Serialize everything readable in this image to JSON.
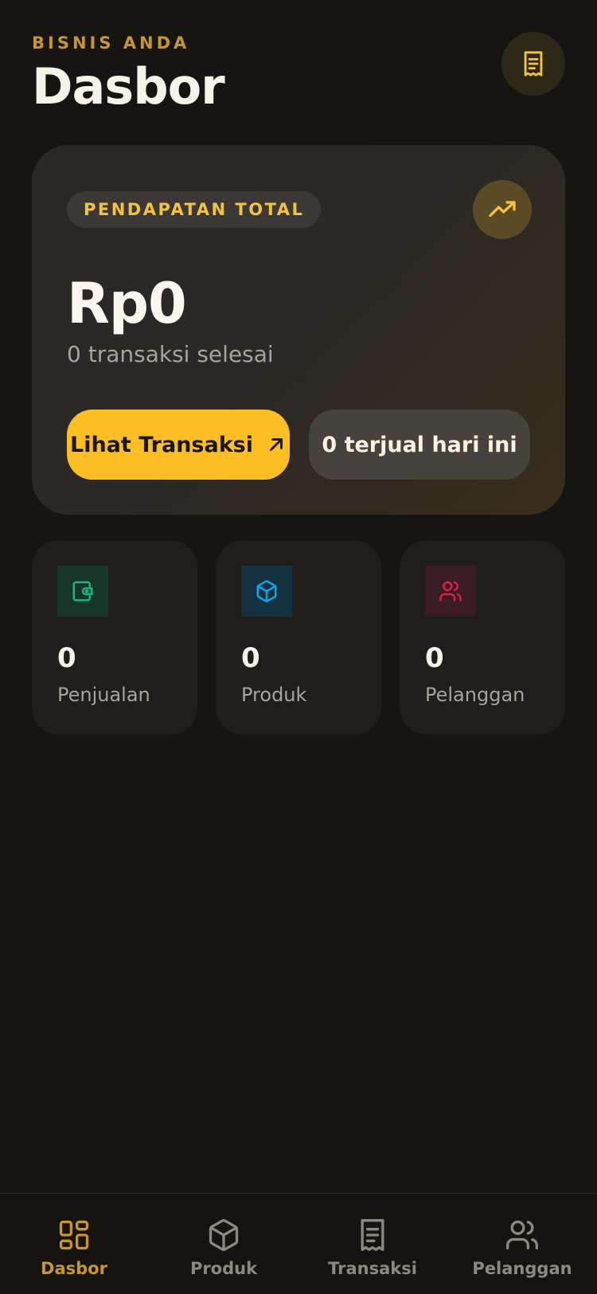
{
  "header": {
    "eyebrow": "BISNIS ANDA",
    "title": "Dasbor",
    "receipt_icon": "receipt-icon"
  },
  "hero": {
    "badge": "PENDAPATAN TOTAL",
    "trend_icon": "trending-up-icon",
    "amount": "Rp0",
    "subtitle": "0 transaksi selesai",
    "primary_button": "Lihat Transaksi",
    "primary_button_icon": "arrow-up-right-icon",
    "secondary_button": "0 terjual hari ini"
  },
  "stats": [
    {
      "value": "0",
      "label": "Penjualan",
      "icon": "wallet-icon",
      "color": "#10b981"
    },
    {
      "value": "0",
      "label": "Produk",
      "icon": "box-icon",
      "color": "#0ea5e9"
    },
    {
      "value": "0",
      "label": "Pelanggan",
      "icon": "users-icon",
      "color": "#e11d48"
    }
  ],
  "nav": {
    "items": [
      {
        "label": "Dasbor",
        "icon": "grid-icon",
        "active": true
      },
      {
        "label": "Produk",
        "icon": "box-icon",
        "active": false
      },
      {
        "label": "Transaksi",
        "icon": "receipt-icon",
        "active": false
      },
      {
        "label": "Pelanggan",
        "icon": "users-icon",
        "active": false
      }
    ]
  },
  "colors": {
    "background": "#161512",
    "accent": "#fbbf24",
    "accent_text": "#c9962c",
    "card": "#1f1e1b"
  }
}
